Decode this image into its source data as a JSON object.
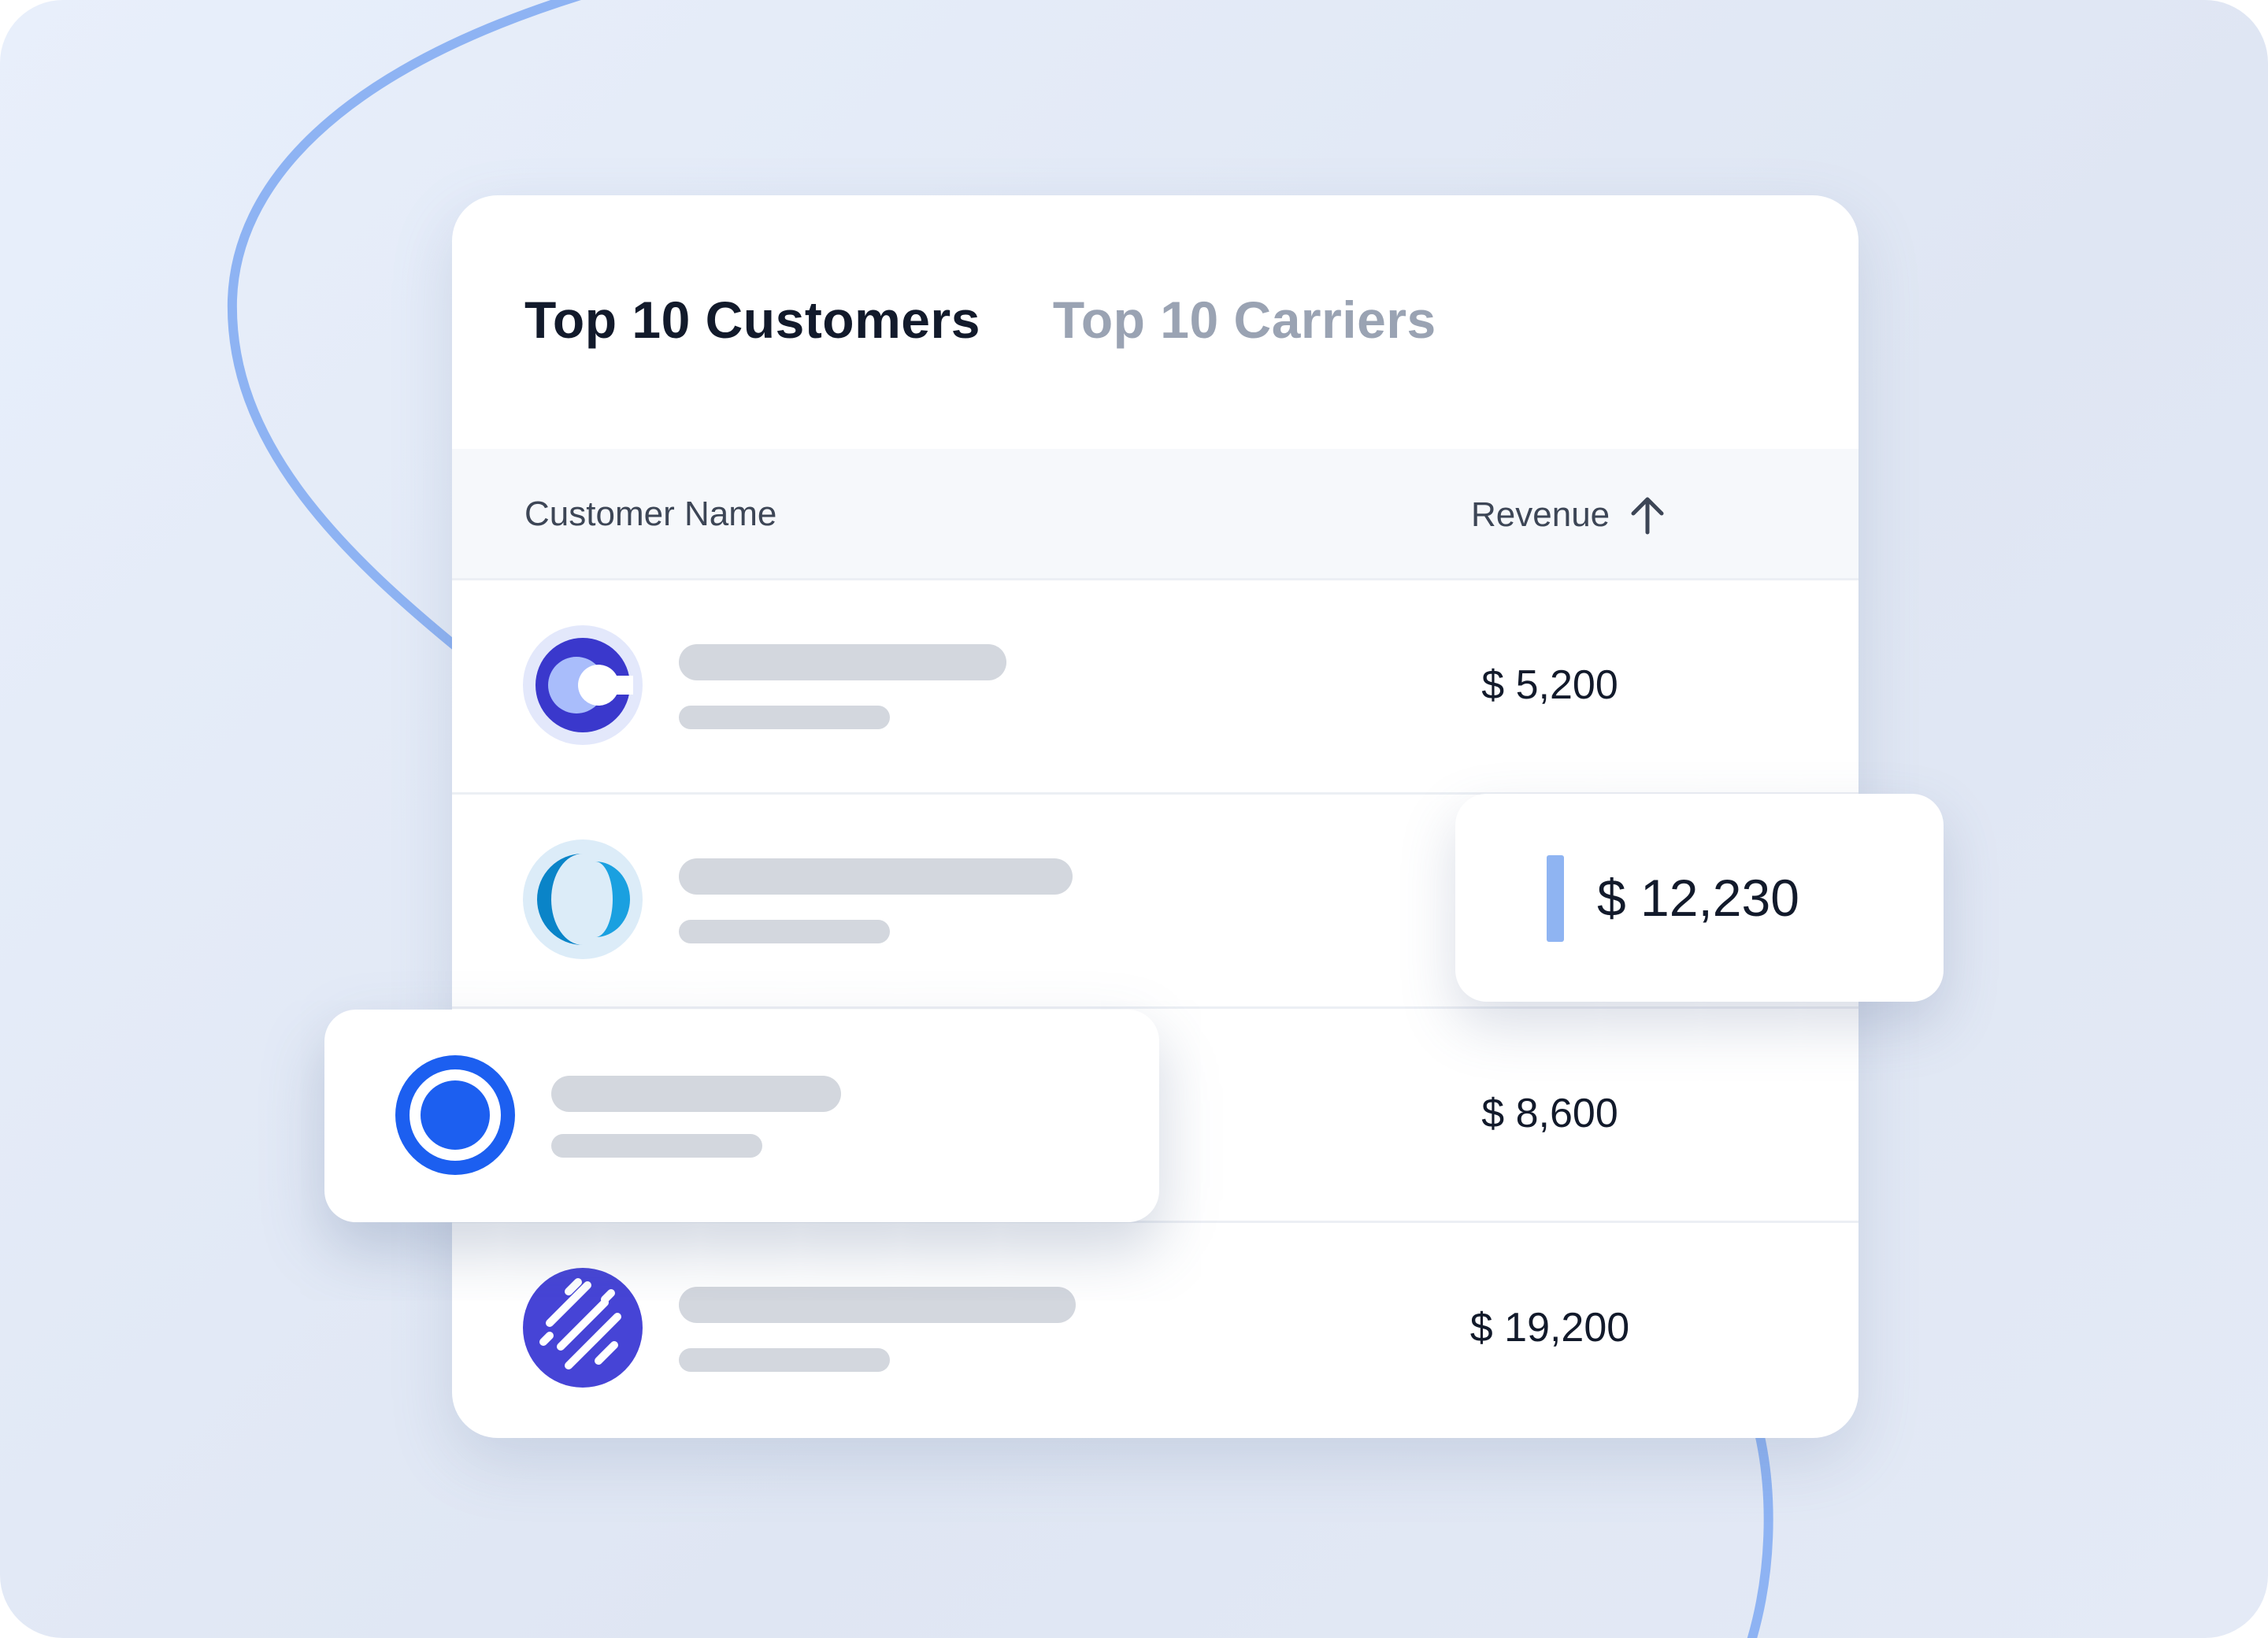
{
  "tabs": [
    {
      "label": "Top 10 Customers",
      "active": true
    },
    {
      "label": "Top 10 Carriers",
      "active": false
    }
  ],
  "table": {
    "col_name": "Customer Name",
    "col_revenue": "Revenue",
    "sort_icon": "arrow-up-icon",
    "rows": [
      {
        "logo": "c-logo-icon",
        "revenue": "$ 5,200"
      },
      {
        "logo": "half-moon-logo-icon",
        "revenue": "$ 12,230"
      },
      {
        "logo": "ring-logo-icon",
        "revenue": "$ 8,600"
      },
      {
        "logo": "striped-circle-logo-icon",
        "revenue": "$ 19,200"
      }
    ]
  },
  "highlight": {
    "revenue": "$ 12,230"
  },
  "colors": {
    "accent_blue": "#1c5ff0",
    "indigo": "#3d3bd4",
    "sky": "#0a8ad0",
    "purple": "#4a46d8",
    "skeleton": "#d3d7de",
    "bar": "#8fb4f2"
  }
}
